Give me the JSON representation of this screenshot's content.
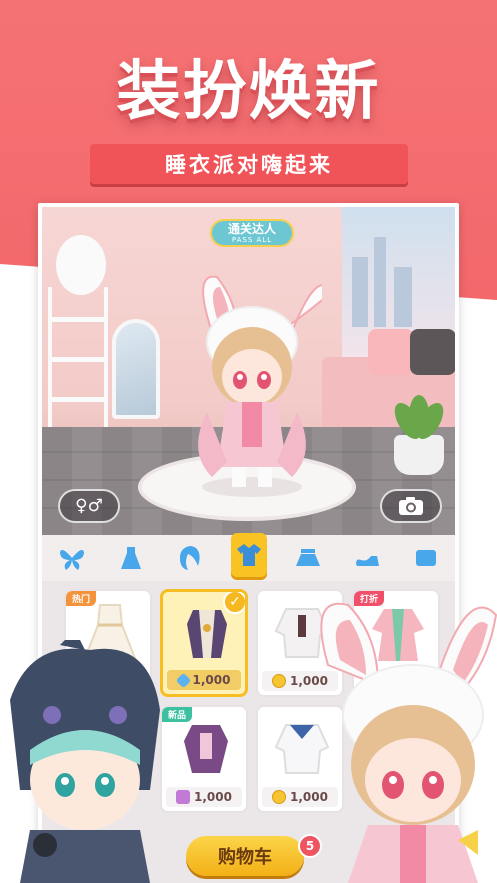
{
  "header": {
    "headline": "装扮焕新",
    "ribbon_text": "睡衣派对嗨起来"
  },
  "room": {
    "badge_title": "通关达人",
    "badge_sub": "PASS ALL",
    "gender_button": "♀♂",
    "camera_icon": "camera-icon"
  },
  "categories": [
    {
      "icon": "wings-icon",
      "active": false
    },
    {
      "icon": "dress-icon",
      "active": false
    },
    {
      "icon": "hair-icon",
      "active": false
    },
    {
      "icon": "shirt-icon",
      "active": true
    },
    {
      "icon": "skirt-icon",
      "active": false
    },
    {
      "icon": "shoe-icon",
      "active": false
    },
    {
      "icon": "accessory-icon",
      "active": false
    }
  ],
  "items": [
    {
      "tag": "热门",
      "price": "",
      "currency": "",
      "selected": false
    },
    {
      "tag": "",
      "price": "1,000",
      "currency": "gem",
      "selected": true
    },
    {
      "tag": "",
      "price": "1,000",
      "currency": "gold",
      "selected": false
    },
    {
      "tag": "打折",
      "price": "",
      "currency": "",
      "selected": false
    },
    {
      "tag": "新品",
      "price": "1,000",
      "currency": "pink",
      "selected": false
    },
    {
      "tag": "",
      "price": "1,000",
      "currency": "gold",
      "selected": false
    }
  ],
  "cart": {
    "label": "购物车",
    "count": "5"
  },
  "colors": {
    "header_red": "#f47274",
    "ribbon_red": "#f05458",
    "active_yellow": "#f9c324",
    "cart_yellow": "#f3b016"
  }
}
